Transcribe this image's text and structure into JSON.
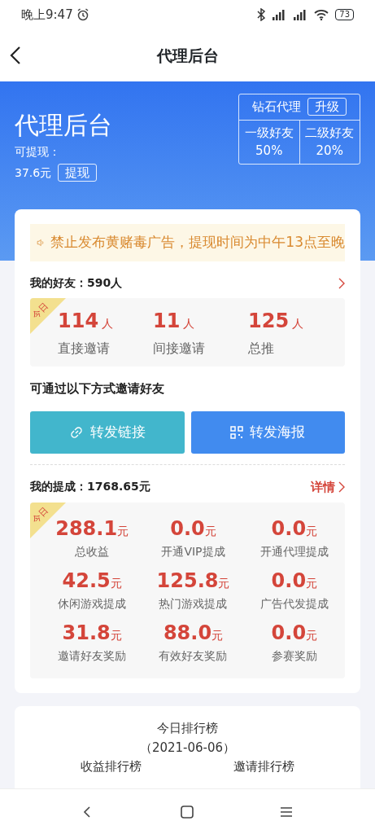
{
  "status_bar": {
    "time": "晚上9:47",
    "battery": "73"
  },
  "header": {
    "title": "代理后台"
  },
  "banner": {
    "title": "代理后台",
    "withdrawable_label": "可提现：",
    "amount": "37.6元",
    "withdraw_button": "提现",
    "level": "钻石代理",
    "upgrade_button": "升级",
    "rates": [
      {
        "label": "一级好友",
        "value": "50%"
      },
      {
        "label": "二级好友",
        "value": "20%"
      }
    ]
  },
  "notice": {
    "text": "禁止发布黄赌毒广告，提现时间为中午13点至晚"
  },
  "friends": {
    "title": "我的好友：590人",
    "badge": "今日",
    "stats": [
      {
        "value": "114",
        "unit": "人",
        "label": "直接邀请"
      },
      {
        "value": "11",
        "unit": "人",
        "label": "间接邀请"
      },
      {
        "value": "125",
        "unit": "人",
        "label": "总推"
      }
    ]
  },
  "invite": {
    "title": "可通过以下方式邀请好友",
    "buttons": [
      {
        "label": "转发链接",
        "kind": "link"
      },
      {
        "label": "转发海报",
        "kind": "poster"
      }
    ]
  },
  "commission": {
    "title": "我的提成：1768.65元",
    "detail_link": "详情",
    "badge": "今日",
    "items": [
      {
        "value": "288.1",
        "unit": "元",
        "label": "总收益"
      },
      {
        "value": "0.0",
        "unit": "元",
        "label": "开通VIP提成"
      },
      {
        "value": "0.0",
        "unit": "元",
        "label": "开通代理提成"
      },
      {
        "value": "42.5",
        "unit": "元",
        "label": "休闲游戏提成"
      },
      {
        "value": "125.8",
        "unit": "元",
        "label": "热门游戏提成"
      },
      {
        "value": "0.0",
        "unit": "元",
        "label": "广告代发提成"
      },
      {
        "value": "31.8",
        "unit": "元",
        "label": "邀请好友奖励"
      },
      {
        "value": "88.0",
        "unit": "元",
        "label": "有效好友奖励"
      },
      {
        "value": "0.0",
        "unit": "元",
        "label": "参赛奖励"
      }
    ]
  },
  "ranking": {
    "title": "今日排行榜",
    "date": "（2021-06-06）",
    "columns": [
      "收益排行榜",
      "邀请排行榜"
    ]
  }
}
